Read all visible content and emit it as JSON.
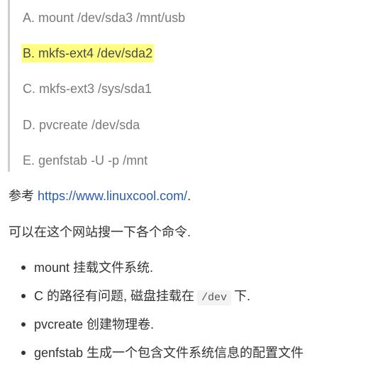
{
  "options": [
    {
      "text": "A. mount /dev/sda3 /mnt/usb",
      "highlighted": false
    },
    {
      "text": "B. mkfs-ext4 /dev/sda2",
      "highlighted": true
    },
    {
      "text": "C. mkfs-ext3 /sys/sda1",
      "highlighted": false
    },
    {
      "text": "D. pvcreate /dev/sda",
      "highlighted": false
    },
    {
      "text": "E. genfstab -U -p /mnt",
      "highlighted": false
    }
  ],
  "reference": {
    "prefix": "参考 ",
    "link_text": "https://www.linuxcool.com/",
    "suffix": "."
  },
  "hint": "可以在这个网站搜一下各个命令.",
  "notes": {
    "item1": "mount 挂载文件系统.",
    "item2_before": "C 的路径有问题, 磁盘挂载在",
    "item2_code": "/dev",
    "item2_after": "下.",
    "item3": "pvcreate 创建物理卷.",
    "item4": "genfstab 生成一个包含文件系统信息的配置文件"
  },
  "colors": {
    "highlight": "#ffff80",
    "link": "#2a5db0",
    "quote_bar": "#cfcfcf"
  }
}
